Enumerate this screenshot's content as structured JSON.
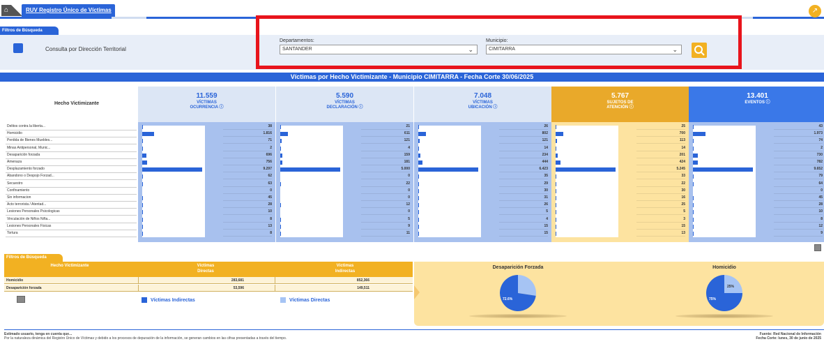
{
  "header": {
    "home_icon": "home-icon",
    "report_tab": "RUV Registro Único de Víctimas ▾",
    "popout_icon": "popout-icon"
  },
  "filters": {
    "tab": "Filtros de Búsqueda",
    "territorial_label": "Consulta por Dirección Territorial",
    "departamento_label": "Departamentos:",
    "departamento_value": "SANTANDER",
    "municipio_label": "Municipio:",
    "municipio_value": "CIMITARRA",
    "search_icon": "search-icon",
    "highlight_color": "#e8141c"
  },
  "title": "Víctimas por Hecho Victimizante - Municipio CIMITARRA - Fecha Corte 30/06/2025",
  "hecho_header": "Hecho Victimizante",
  "rows": [
    "Delitos contra la liberta...",
    "Homicidio",
    "Perdida de Bienes Muebles...",
    "Minas Antipersonal, Munic...",
    "Desaparición forzada",
    "Amenaza",
    "Desplazamiento forzado",
    "Abandono o Despojo Forzad...",
    "Secuestro",
    "Confinamiento",
    "Sin informacion",
    "Acto terrorista / Atentad...",
    "Lesiones Personales Psicologicas",
    "Vinculación de Niños Niña...",
    "Lesiones Personales Fisicas",
    "Tortura"
  ],
  "columns": [
    {
      "total": "11.559",
      "label1": "VÍCTIMAS",
      "label2": "OCURRENCIA ⓘ",
      "bg": "#a8c1ee",
      "head_bg": "#dce6f5",
      "head_color": "#2a64d8",
      "max": 9297,
      "values": [
        "38",
        "1.816",
        "71",
        "2",
        "696",
        "756",
        "9.297",
        "62",
        "63",
        "0",
        "45",
        "28",
        "10",
        "8",
        "13",
        "8"
      ],
      "nums": [
        38,
        1816,
        71,
        2,
        696,
        756,
        9297,
        62,
        63,
        0,
        45,
        28,
        10,
        8,
        13,
        8
      ]
    },
    {
      "total": "5.590",
      "label1": "VÍCTIMAS",
      "label2": "DECLARACIÓN ⓘ",
      "bg": "#a8c1ee",
      "head_bg": "#dce6f5",
      "head_color": "#2a64d8",
      "max": 5000,
      "values": [
        "21",
        "611",
        "121",
        "4",
        "159",
        "181",
        "5.000",
        "0",
        "22",
        "0",
        "0",
        "12",
        "0",
        "5",
        "9",
        "11"
      ],
      "nums": [
        21,
        611,
        121,
        4,
        159,
        181,
        5000,
        0,
        22,
        0,
        0,
        12,
        0,
        5,
        9,
        11
      ]
    },
    {
      "total": "7.048",
      "label1": "VÍCTIMAS",
      "label2": "UBICACIÓN ⓘ",
      "bg": "#a8c1ee",
      "head_bg": "#dce6f5",
      "head_color": "#2a64d8",
      "max": 6423,
      "values": [
        "26",
        "802",
        "121",
        "14",
        "234",
        "444",
        "6.423",
        "35",
        "29",
        "30",
        "31",
        "26",
        "5",
        "4",
        "15",
        "15"
      ],
      "nums": [
        26,
        802,
        121,
        14,
        234,
        444,
        6423,
        35,
        29,
        30,
        31,
        26,
        5,
        4,
        15,
        15
      ]
    },
    {
      "total": "5.767",
      "label1": "SUJETOS DE",
      "label2": "ATENCIÓN ⓘ",
      "bg": "#fde3a0",
      "head_bg": "#e9a92a",
      "head_color": "#ffffff",
      "max": 5245,
      "values": [
        "25",
        "700",
        "113",
        "14",
        "201",
        "424",
        "5.245",
        "33",
        "22",
        "30",
        "16",
        "25",
        "5",
        "3",
        "15",
        "13"
      ],
      "nums": [
        25,
        700,
        113,
        14,
        201,
        424,
        5245,
        33,
        22,
        30,
        16,
        25,
        5,
        3,
        15,
        13
      ]
    },
    {
      "total": "13.401",
      "label1": "EVENTOS ⓘ",
      "label2": "",
      "bg": "#a8c1ee",
      "head_bg": "#3a78e8",
      "head_color": "#ffffff",
      "max": 9652,
      "values": [
        "43",
        "1.973",
        "74",
        "2",
        "730",
        "782",
        "9.652",
        "79",
        "64",
        "0",
        "45",
        "28",
        "10",
        "8",
        "12",
        "9"
      ],
      "nums": [
        43,
        1973,
        74,
        2,
        730,
        782,
        9652,
        79,
        64,
        0,
        45,
        28,
        10,
        8,
        12,
        9
      ]
    }
  ],
  "bottom": {
    "tab": "Filtros de Búsqueda",
    "col_hecho": "Hecho Victimizante",
    "col_directas": "Víctimas Directas",
    "col_indirectas": "Víctimas Indirectas",
    "rows": [
      {
        "hecho": "Homicidio",
        "directas": "283,681",
        "indirectas": "852,366"
      },
      {
        "hecho": "Desaparición forzada",
        "directas": "53,596",
        "indirectas": "149,511"
      }
    ],
    "legend_indirectas": "Víctimas Indirectas",
    "legend_directas": "Víctimas Directas",
    "excel_icon": "excel-export-icon"
  },
  "chart_data": [
    {
      "type": "pie",
      "title": "Desaparición Forzada",
      "categories": [
        "Víctimas Indirectas",
        "Víctimas Directas"
      ],
      "values": [
        72.6,
        27.4
      ],
      "data_labels": [
        "72.6%",
        ""
      ],
      "colors": [
        "#2a64d8",
        "#a6c4f4"
      ]
    },
    {
      "type": "pie",
      "title": "Homicidio",
      "categories": [
        "Víctimas Indirectas",
        "Víctimas Directas"
      ],
      "values": [
        75,
        25
      ],
      "data_labels": [
        "75%",
        "25%"
      ],
      "colors": [
        "#2a64d8",
        "#a6c4f4"
      ]
    }
  ],
  "footer": {
    "left1": "Estimado usuario, tenga en cuenta que...",
    "left2": "Por la naturaleza dinámica del Registro Único de Víctimas y debido a los procesos de depuración de la información, se generan cambios en las cifras presentadas a través del tiempo.",
    "right1": "Fuente: Red Nacional de Información",
    "right2": "Fecha Corte: lunes, 30 de junio de 2025"
  }
}
